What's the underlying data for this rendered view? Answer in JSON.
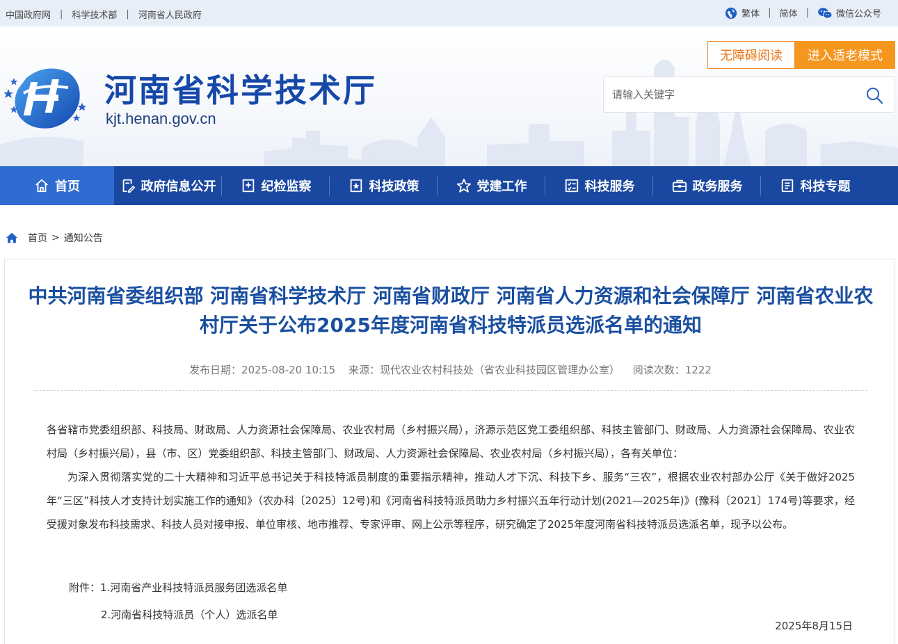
{
  "topbar": {
    "links": [
      "中国政府网",
      "科学技术部",
      "河南省人民政府"
    ],
    "separator": "|",
    "traditional": "繁体",
    "simplified": "简体",
    "wechat": "微信公众号"
  },
  "header": {
    "title": "河南省科学技术厅",
    "domain": "kjt.henan.gov.cn",
    "accessible_label": "无障碍阅读",
    "elder_label": "进入适老模式",
    "search_placeholder": "请输入关键字"
  },
  "nav": {
    "items": [
      {
        "label": "首页",
        "icon": "home-icon"
      },
      {
        "label": "政府信息公开",
        "icon": "document-edit-icon"
      },
      {
        "label": "纪检监察",
        "icon": "inspection-icon"
      },
      {
        "label": "科技政策",
        "icon": "policy-icon"
      },
      {
        "label": "党建工作",
        "icon": "star-icon"
      },
      {
        "label": "科技服务",
        "icon": "checklist-icon"
      },
      {
        "label": "政务服务",
        "icon": "briefcase-icon"
      },
      {
        "label": "科技专题",
        "icon": "notes-icon"
      }
    ],
    "active_index": 0
  },
  "breadcrumb": {
    "home": "首页",
    "sep": ">",
    "current": "通知公告"
  },
  "article": {
    "title": "中共河南省委组织部 河南省科学技术厅 河南省财政厅 河南省人力资源和社会保障厅 河南省农业农村厅关于公布2025年度河南省科技特派员选派名单的通知",
    "publish_date": "发布日期：2025-08-20 10:15",
    "source": "来源：现代农业农村科技处（省农业科技园区管理办公室）",
    "views": "阅读次数：1222",
    "para1": "各省辖市党委组织部、科技局、财政局、人力资源社会保障局、农业农村局（乡村振兴局），济源示范区党工委组织部、科技主管部门、财政局、人力资源社会保障局、农业农村局（乡村振兴局），县（市、区）党委组织部、科技主管部门、财政局、人力资源社会保障局、农业农村局（乡村振兴局），各有关单位：",
    "para2": "为深入贯彻落实党的二十大精神和习近平总书记关于科技特派员制度的重要指示精神，推动人才下沉、科技下乡、服务“三农”，根据农业农村部办公厅《关于做好2025年“三区”科技人才支持计划实施工作的通知》（农办科〔2025〕12号)和《河南省科技特派员助力乡村振兴五年行动计划(2021—2025年)》(豫科〔2021〕174号)等要求，经受援对象发布科技需求、科技人员对接申报、单位审核、地市推荐、专家评审、网上公示等程序，研究确定了2025年度河南省科技特派员选派名单，现予以公布。",
    "attach1": "附件：1.河南省产业科技特派员服务团选派名单",
    "attach2": "2.河南省科技特派员（个人）选派名单",
    "date": "2025年8月15日"
  },
  "colors": {
    "brand_blue": "#1a47a0",
    "nav_active": "#2f6bd0",
    "title_blue": "#1a4fa0",
    "orange": "#f5961f",
    "topbar_bg": "#e8eef7"
  }
}
